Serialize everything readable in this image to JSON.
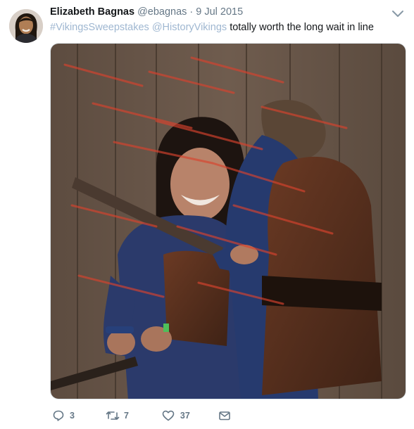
{
  "tweet": {
    "author_name": "Elizabeth Bagnas",
    "handle": "@ebagnas",
    "separator": "·",
    "date": "9 Jul 2015",
    "hashtag": "#VikingsSweepstakes",
    "mention": "@HistoryVikings",
    "text": "totally worth the long wait in line"
  },
  "actions": {
    "reply_count": "3",
    "retweet_count": "7",
    "like_count": "37"
  },
  "icons": {
    "reply": "reply-icon",
    "retweet": "retweet-icon",
    "like": "heart-icon",
    "dm": "envelope-icon",
    "menu": "chevron-down-icon"
  },
  "colors": {
    "link": "#9fb7d1",
    "secondary_text": "#657786",
    "primary_text": "#14171a"
  }
}
